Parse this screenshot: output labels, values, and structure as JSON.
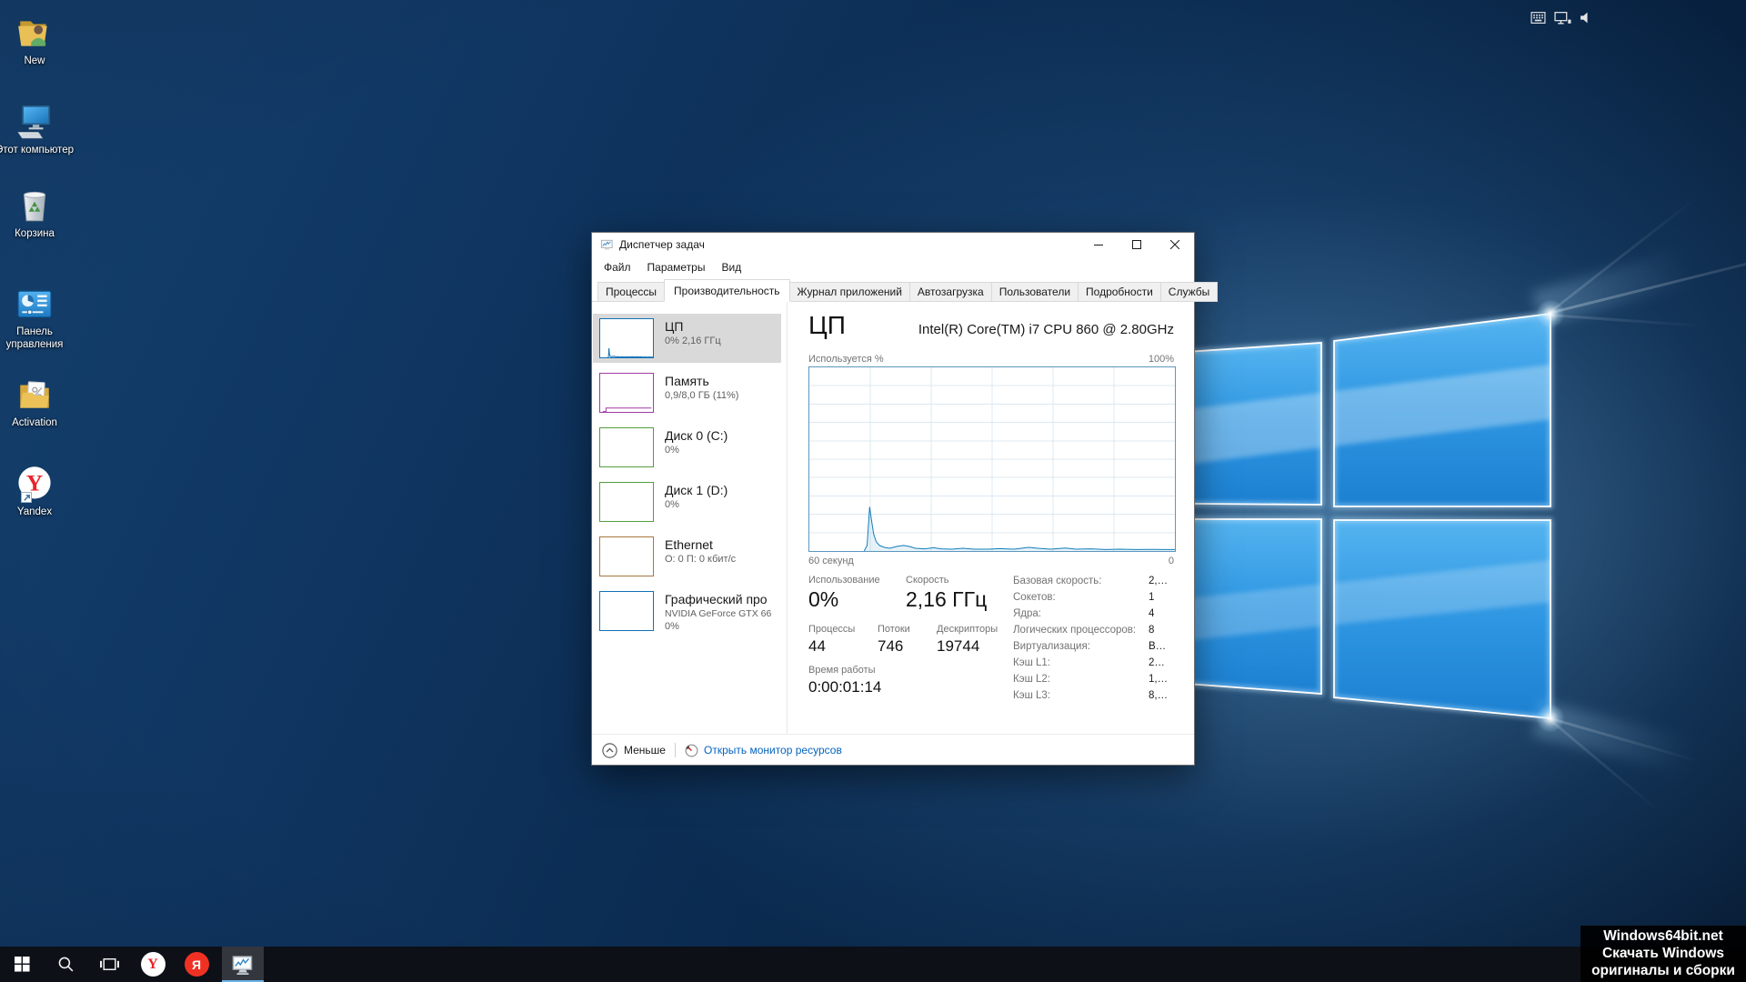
{
  "desktop": {
    "icons": [
      {
        "label": "New",
        "icon": "folder-user"
      },
      {
        "label": "Этот компьютер",
        "icon": "this-pc"
      },
      {
        "label": "Корзина",
        "icon": "recycle-bin"
      },
      {
        "label": "Панель управления",
        "icon": "control-panel"
      },
      {
        "label": "Activation",
        "icon": "folder-activation"
      },
      {
        "label": "Yandex",
        "icon": "yandex-browser"
      }
    ],
    "watermark": {
      "line1": "Windows64bit.net",
      "line2": "Скачать Windows",
      "line3": "оригиналы и сборки"
    }
  },
  "taskbar": {
    "yandex_browser_letter": "Y",
    "yandex_letter": "Я"
  },
  "task_manager": {
    "title": "Диспетчер задач",
    "menu": [
      {
        "label": "Файл"
      },
      {
        "label": "Параметры"
      },
      {
        "label": "Вид"
      }
    ],
    "tabs": [
      {
        "label": "Процессы",
        "active": false
      },
      {
        "label": "Производительность",
        "active": true
      },
      {
        "label": "Журнал приложений",
        "active": false
      },
      {
        "label": "Автозагрузка",
        "active": false
      },
      {
        "label": "Пользователи",
        "active": false
      },
      {
        "label": "Подробности",
        "active": false
      },
      {
        "label": "Службы",
        "active": false
      }
    ],
    "sidebar": [
      {
        "title": "ЦП",
        "subtitle": "0% 2,16 ГГц",
        "color": "#1271b5",
        "selected": true
      },
      {
        "title": "Память",
        "subtitle": "0,9/8,0 ГБ (11%)",
        "color": "#a23aa8",
        "thumb_points": [
          [
            0.05,
            1
          ],
          [
            0.11,
            1
          ],
          [
            0.11,
            10
          ],
          [
            0.97,
            10
          ]
        ]
      },
      {
        "title": "Диск 0 (C:)",
        "subtitle": "0%",
        "color": "#549e3f"
      },
      {
        "title": "Диск 1 (D:)",
        "subtitle": "0%",
        "color": "#549e3f"
      },
      {
        "title": "Ethernet",
        "subtitle": "О: 0 П: 0 кбит/с",
        "color": "#a8763e"
      },
      {
        "title": "Графический про",
        "subtitle": "NVIDIA GeForce GTX 66",
        "subtitle2": "0%",
        "color": "#1271b5"
      }
    ],
    "main": {
      "title": "ЦП",
      "device_name": "Intel(R) Core(TM) i7 CPU 860 @ 2.80GHz",
      "chart": {
        "top_left": "Используется %",
        "top_right": "100%",
        "bottom_left": "60 секунд",
        "bottom_right": "0",
        "line_color": "#117dbb",
        "fill_color": "rgba(17,125,187,0.10)",
        "grid_cols": 6,
        "grid_rows": 10,
        "points": [
          [
            0.15,
            0
          ],
          [
            0.158,
            3
          ],
          [
            0.165,
            24
          ],
          [
            0.17,
            17
          ],
          [
            0.176,
            9
          ],
          [
            0.183,
            5
          ],
          [
            0.192,
            3
          ],
          [
            0.205,
            2
          ],
          [
            0.22,
            1.5
          ],
          [
            0.24,
            2.5
          ],
          [
            0.258,
            3
          ],
          [
            0.272,
            2.5
          ],
          [
            0.29,
            1.5
          ],
          [
            0.315,
            1.2
          ],
          [
            0.34,
            1.8
          ],
          [
            0.36,
            1.2
          ],
          [
            0.39,
            1.0
          ],
          [
            0.42,
            1.5
          ],
          [
            0.45,
            1.0
          ],
          [
            0.49,
            1.0
          ],
          [
            0.52,
            1.3
          ],
          [
            0.56,
            1.0
          ],
          [
            0.6,
            2.0
          ],
          [
            0.625,
            1.5
          ],
          [
            0.66,
            1.0
          ],
          [
            0.7,
            1.6
          ],
          [
            0.73,
            1.0
          ],
          [
            0.77,
            1.2
          ],
          [
            0.81,
            0.8
          ],
          [
            0.85,
            1.0
          ],
          [
            0.89,
            0.8
          ],
          [
            0.93,
            0.9
          ],
          [
            0.97,
            0.8
          ],
          [
            1.0,
            0.8
          ]
        ]
      },
      "stats": {
        "usage_label": "Использование",
        "usage_value": "0%",
        "speed_label": "Скорость",
        "speed_value": "2,16 ГГц",
        "processes_label": "Процессы",
        "processes_value": "44",
        "threads_label": "Потоки",
        "threads_value": "746",
        "handles_label": "Дескрипторы",
        "handles_value": "19744",
        "uptime_label": "Время работы",
        "uptime_value": "0:00:01:14"
      },
      "details": [
        {
          "label": "Базовая скорость:",
          "value": "2,…"
        },
        {
          "label": "Сокетов:",
          "value": "1"
        },
        {
          "label": "Ядра:",
          "value": "4"
        },
        {
          "label": "Логических процессоров:",
          "value": "8"
        },
        {
          "label": "Виртуализация:",
          "value": "В…"
        },
        {
          "label": "Кэш L1:",
          "value": "2…"
        },
        {
          "label": "Кэш L2:",
          "value": "1,…"
        },
        {
          "label": "Кэш L3:",
          "value": "8,…"
        }
      ]
    },
    "footer": {
      "less_label": "Меньше",
      "link_label": "Открыть монитор ресурсов"
    }
  },
  "chart_data": {
    "type": "line",
    "title": "ЦП — Используется %",
    "xlabel": "60 секунд → 0",
    "ylabel": "Используется %",
    "ylim": [
      0,
      100
    ],
    "x_window_seconds": 60,
    "grid": true,
    "series": [
      {
        "name": "CPU usage %",
        "points_fraction_pct": [
          [
            0.15,
            0
          ],
          [
            0.165,
            24
          ],
          [
            0.176,
            9
          ],
          [
            0.192,
            3
          ],
          [
            0.22,
            1.5
          ],
          [
            0.258,
            3
          ],
          [
            0.29,
            1.5
          ],
          [
            0.34,
            1.8
          ],
          [
            0.39,
            1.0
          ],
          [
            0.45,
            1.0
          ],
          [
            0.52,
            1.3
          ],
          [
            0.6,
            2.0
          ],
          [
            0.66,
            1.0
          ],
          [
            0.73,
            1.0
          ],
          [
            0.81,
            0.8
          ],
          [
            0.89,
            0.8
          ],
          [
            0.97,
            0.8
          ],
          [
            1.0,
            0.8
          ]
        ]
      }
    ]
  }
}
